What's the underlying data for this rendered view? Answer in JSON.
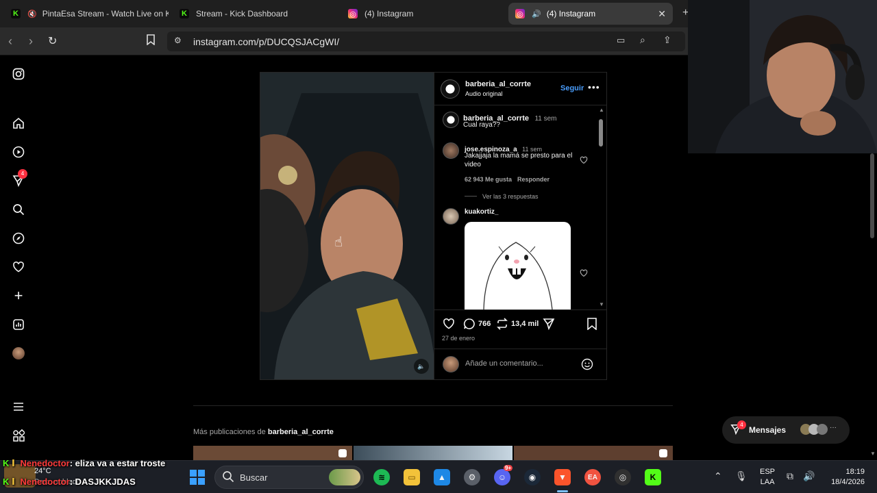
{
  "tabs": [
    {
      "label": "PintaEsa Stream - Watch Live on K"
    },
    {
      "label": "Stream - Kick Dashboard"
    },
    {
      "label": "(4) Instagram"
    },
    {
      "label": "(4) Instagram"
    }
  ],
  "address": {
    "url": "instagram.com/p/DUCQSJACgWI/"
  },
  "nav": {
    "notif_badge": "4"
  },
  "post": {
    "author": "barberia_al_corrte",
    "audio": "Audio original",
    "follow": "Seguir",
    "caption": {
      "user": "barberia_al_corrte",
      "time": "11 sem",
      "text": "Cual raya??"
    },
    "comments": [
      {
        "user": "jose.espinoza_a",
        "time": "11 sem",
        "text": "Jakajjaja la mamá se presto para el video",
        "likes": "62 943 Me gusta",
        "reply": "Responder",
        "view_replies": "Ver las 3 respuestas"
      },
      {
        "user": "kuakortiz_"
      }
    ],
    "comment_count": "766",
    "repost_count": "13,4 mil",
    "date": "27 de enero",
    "add_comment_placeholder": "Añade un comentario..."
  },
  "more": {
    "prefix": "Más publicaciones de",
    "user": "barberia_al_corrte"
  },
  "messages": {
    "label": "Mensajes",
    "badge": "4"
  },
  "chat": [
    {
      "user": "Nenedoctor",
      "text": ": eliza va a estar troste"
    },
    {
      "user": "Nenedoctor",
      "text": ": DASJKKJDAS"
    }
  ],
  "weather": {
    "temp": "24°C",
    "desc": "Parc. nublado"
  },
  "taskbar": {
    "search": "Buscar",
    "lang_top": "ESP",
    "lang_bottom": "LAA",
    "time": "18:19",
    "date": "18/4/2026",
    "discord_badge": "9+"
  },
  "colors": {
    "accent": "#4a9eff",
    "kick": "#53fc18",
    "notif": "#ff3040"
  }
}
